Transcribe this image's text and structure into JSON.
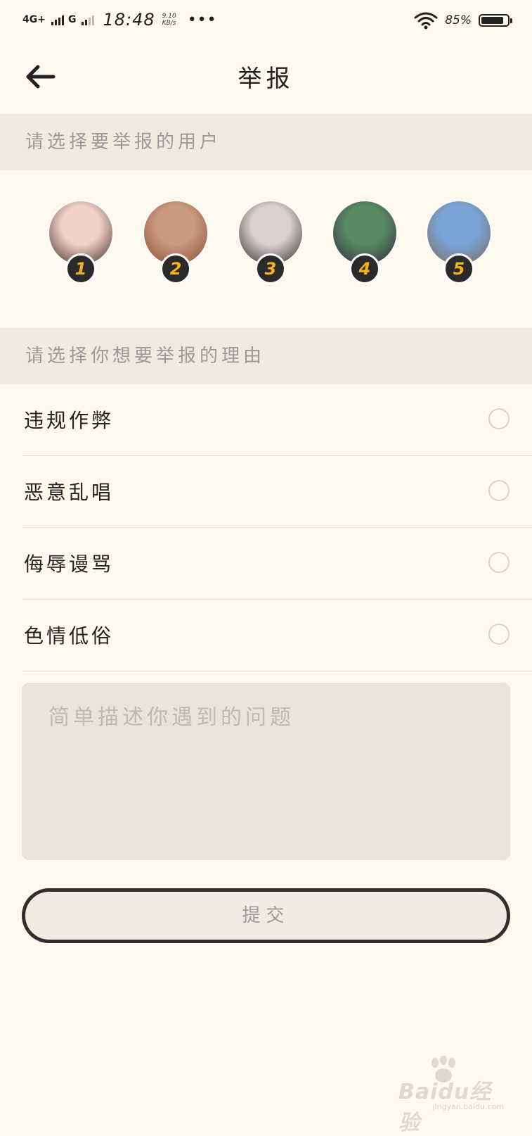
{
  "status_bar": {
    "network1": "4G+",
    "network2": "G",
    "time": "18:48",
    "speed_value": "9.10",
    "speed_unit": "KB/s",
    "more": "•••",
    "battery_pct": "85%",
    "battery_level": 0.85
  },
  "header": {
    "title": "举报",
    "back_icon": "arrow-left-icon"
  },
  "user_section": {
    "title": "请选择要举报的用户",
    "users": [
      {
        "number": "1",
        "avatar_colors": [
          "#f2d2c6",
          "#3a2622"
        ]
      },
      {
        "number": "2",
        "avatar_colors": [
          "#c99a7e",
          "#8a4a32"
        ]
      },
      {
        "number": "3",
        "avatar_colors": [
          "#d9d2cf",
          "#2d2420"
        ]
      },
      {
        "number": "4",
        "avatar_colors": [
          "#5a8a64",
          "#2c2b38"
        ]
      },
      {
        "number": "5",
        "avatar_colors": [
          "#7aa5d9",
          "#7a6a56"
        ]
      }
    ]
  },
  "reason_section": {
    "title": "请选择你想要举报的理由",
    "options": [
      {
        "label": "违规作弊",
        "selected": false
      },
      {
        "label": "恶意乱唱",
        "selected": false
      },
      {
        "label": "侮辱谩骂",
        "selected": false
      },
      {
        "label": "色情低俗",
        "selected": false
      }
    ]
  },
  "description": {
    "placeholder": "简单描述你遇到的问题",
    "value": ""
  },
  "submit_label": "提交",
  "watermark": {
    "brand": "Baidu经验",
    "url": "jingyan.baidu.com"
  },
  "colors": {
    "background": "#fdf9ef",
    "section_bg": "#efebe1",
    "badge_text": "#f5b21a",
    "badge_bg": "#2a2a2a"
  }
}
